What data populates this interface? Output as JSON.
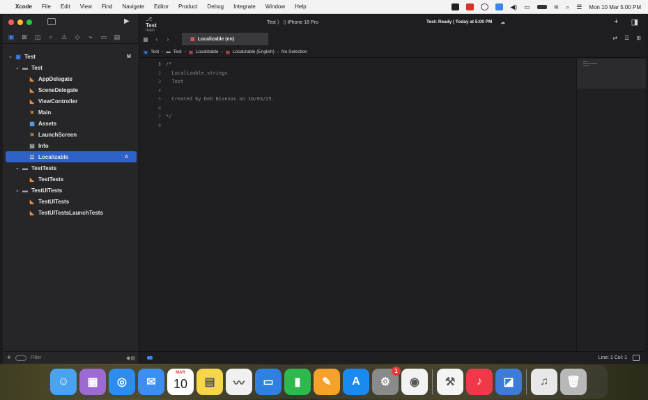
{
  "menubar": {
    "apple_glyph": "",
    "items": [
      "Xcode",
      "File",
      "Edit",
      "View",
      "Find",
      "Navigate",
      "Editor",
      "Product",
      "Debug",
      "Integrate",
      "Window",
      "Help"
    ],
    "clock": "Mon 10 Mar  5:00 PM"
  },
  "window": {
    "branch_title": "Test",
    "branch_sub": "main",
    "scheme": "Test  〉 ▯ iPhone 16 Pro",
    "status": "Test: Ready | Today at 5:00 PM",
    "tab_label": "Localizable (en)",
    "jumpbar": [
      "Test",
      "Test",
      "Localizable",
      "Localizable (English)",
      "No Selection"
    ],
    "line_col": "Line: 1  Col: 1"
  },
  "navigator": {
    "tree": [
      {
        "label": "Test",
        "icon": "project-icon",
        "level": 0,
        "chevron": "⌄",
        "mark": "M"
      },
      {
        "label": "Test",
        "icon": "folder-icon",
        "level": 1,
        "chevron": "⌄"
      },
      {
        "label": "AppDelegate",
        "icon": "swift-icon",
        "level": 2
      },
      {
        "label": "SceneDelegate",
        "icon": "swift-icon",
        "level": 2
      },
      {
        "label": "ViewController",
        "icon": "swift-icon",
        "level": 2
      },
      {
        "label": "Main",
        "icon": "storyboard-icon",
        "level": 2
      },
      {
        "label": "Assets",
        "icon": "assets-icon",
        "level": 2
      },
      {
        "label": "LaunchScreen",
        "icon": "storyboard-icon",
        "level": 2
      },
      {
        "label": "Info",
        "icon": "plist-icon",
        "level": 2
      },
      {
        "label": "Localizable",
        "icon": "strings-icon",
        "level": 2,
        "selected": true,
        "mark": "A"
      },
      {
        "label": "TestTests",
        "icon": "folder-icon",
        "level": 1,
        "chevron": "⌄"
      },
      {
        "label": "TestTests",
        "icon": "swift-icon",
        "level": 2
      },
      {
        "label": "TestUITests",
        "icon": "folder-icon",
        "level": 1,
        "chevron": "⌄"
      },
      {
        "label": "TestUITests",
        "icon": "swift-icon",
        "level": 2
      },
      {
        "label": "TestUITestsLaunchTests",
        "icon": "swift-icon",
        "level": 2
      }
    ],
    "filter_placeholder": "Filter"
  },
  "editor": {
    "lines": [
      "/*",
      "  Localizable.strings",
      "  Test",
      "",
      "  Created by Deb Bisenas on 10/03/25.",
      "",
      "*/",
      ""
    ],
    "numbers": [
      "1",
      "2",
      "3",
      "4",
      "5",
      "6",
      "7",
      "8"
    ]
  },
  "dock": {
    "apps": [
      {
        "name": "finder-icon",
        "color": "#4aa3f0",
        "glyph": "☺"
      },
      {
        "name": "launchpad-icon",
        "color": "#9d6ad4",
        "glyph": "▦"
      },
      {
        "name": "safari-icon",
        "color": "#2d8cf0",
        "glyph": "◎"
      },
      {
        "name": "mail-icon",
        "color": "#3a8ff0",
        "glyph": "✉"
      },
      {
        "name": "calendar-icon",
        "color": "#ffffff",
        "glyph": "",
        "month": "MAR",
        "day": "10"
      },
      {
        "name": "notes-icon",
        "color": "#f6d64a",
        "glyph": "▤"
      },
      {
        "name": "freeform-icon",
        "color": "#f0f0f0",
        "glyph": "〰"
      },
      {
        "name": "keynote-icon",
        "color": "#2f80e0",
        "glyph": "▭"
      },
      {
        "name": "numbers-icon",
        "color": "#2fb84e",
        "glyph": "▮"
      },
      {
        "name": "pages-icon",
        "color": "#f5a12a",
        "glyph": "✎"
      },
      {
        "name": "appstore-icon",
        "color": "#1b8af0",
        "glyph": "A"
      },
      {
        "name": "settings-icon",
        "color": "#8a8a8a",
        "glyph": "⚙",
        "badge": "1"
      },
      {
        "name": "chrome-icon",
        "color": "#f2f2f2",
        "glyph": "◉"
      },
      {
        "name": "xcode-icon",
        "color": "#f4f4f4",
        "glyph": "⚒"
      },
      {
        "name": "music-icon",
        "color": "#f0384a",
        "glyph": "♪"
      },
      {
        "name": "simulator-icon",
        "color": "#3a7cd8",
        "glyph": "◪"
      },
      {
        "name": "audio-file-icon",
        "color": "#e8e8e8",
        "glyph": "♫"
      },
      {
        "name": "trash-icon",
        "color": "#b8b8b8",
        "glyph": "🗑"
      }
    ]
  }
}
